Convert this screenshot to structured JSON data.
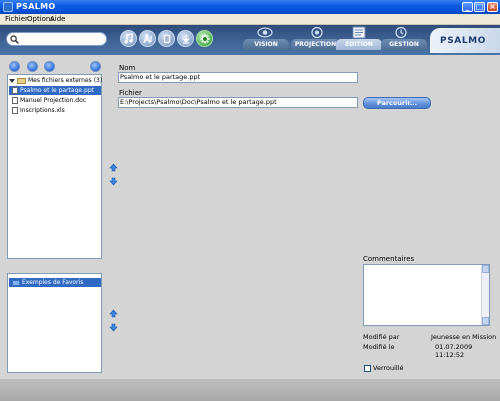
{
  "window": {
    "title": "PSALMO"
  },
  "menu": {
    "items": [
      "Fichier",
      "Options",
      "Aide"
    ]
  },
  "toolbar": {
    "search_value": "",
    "icons": [
      "search-icon",
      "music-note-icon",
      "singer-icon",
      "list-icon",
      "download-icon",
      "settings-icon"
    ]
  },
  "tabs": [
    {
      "label": "VISION",
      "active": false
    },
    {
      "label": "PROJECTION",
      "active": false
    },
    {
      "label": "EDITION",
      "active": true
    },
    {
      "label": "GESTION",
      "active": false
    }
  ],
  "logo_text": "PSALMO",
  "tree": {
    "root_label": "Mes fichiers externes (3)",
    "items": [
      {
        "label": "Psalmo et le partage.ppt",
        "selected": true
      },
      {
        "label": "Manuel Projection.doc",
        "selected": false
      },
      {
        "label": "Inscriptions.xls",
        "selected": false
      }
    ]
  },
  "favorites": {
    "items": [
      {
        "label": "Exemples de Favoris",
        "selected": true
      }
    ]
  },
  "form": {
    "name_label": "Nom",
    "name_value": "Psalmo et le partage.ppt",
    "file_label": "Fichier",
    "file_value": "E:\\Projects\\Psalmo\\Doc\\Psalmo et le partage.ppt",
    "browse_label": "Parcourir..."
  },
  "details": {
    "comments_label": "Commentaires",
    "modified_by_label": "Modifié par",
    "modified_by_value": "Jeunesse en Mission",
    "modified_on_label": "Modifié le",
    "modified_on_value": "01.07.2009 11:12:52",
    "locked_label": "Verrouillé",
    "locked": false
  },
  "colors": {
    "title_blue": "#0a5ce0",
    "selection": "#316ac5",
    "toolbar": "#3f6293",
    "browse": "#5d8fdb"
  }
}
